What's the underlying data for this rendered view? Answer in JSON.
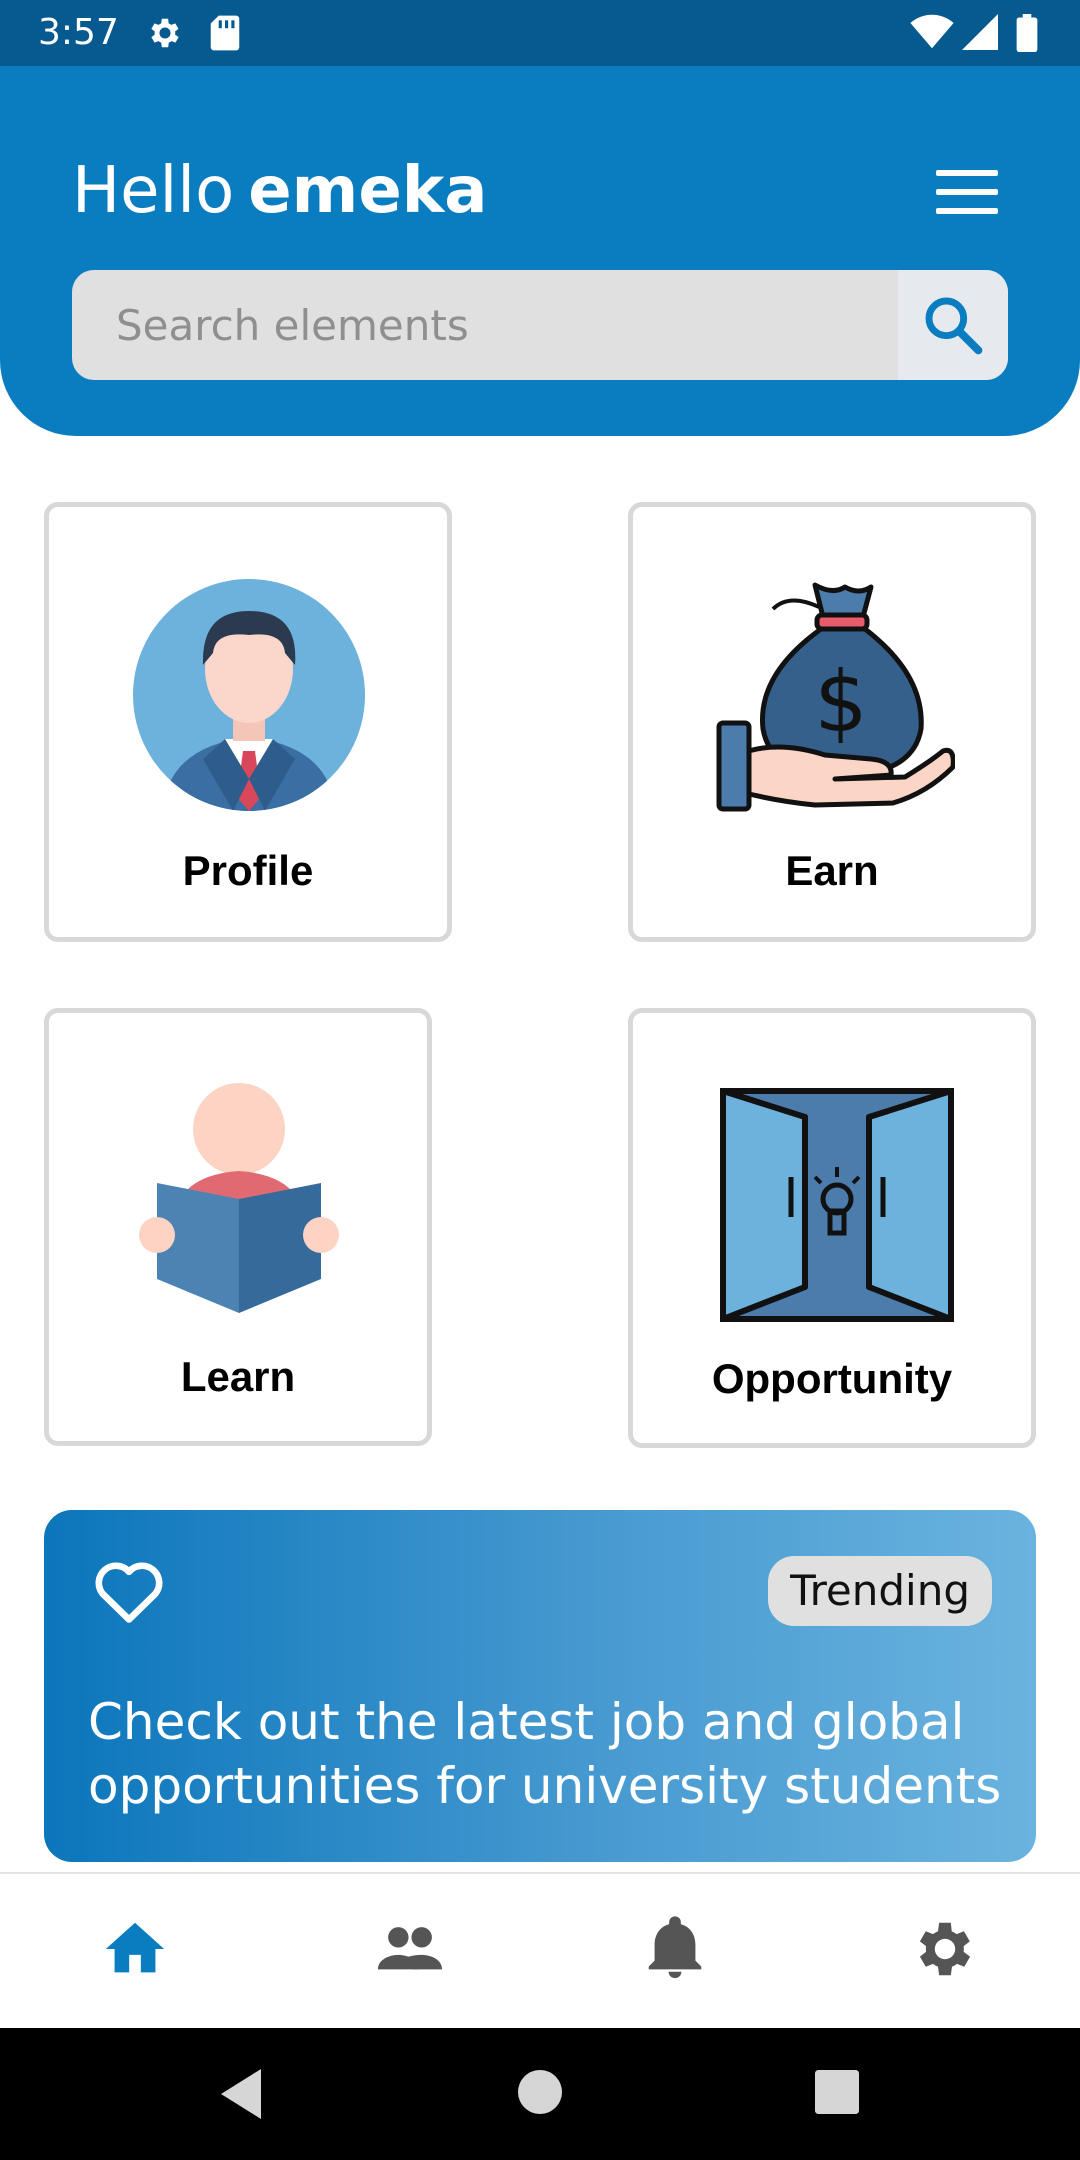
{
  "status_bar": {
    "time": "3:57",
    "icons": [
      "settings-gear-icon",
      "sd-card-icon",
      "wifi-icon",
      "signal-icon",
      "battery-icon"
    ]
  },
  "header": {
    "greeting_prefix": "Hello",
    "user_name": "emeka",
    "menu_icon": "hamburger-menu-icon"
  },
  "search": {
    "placeholder": "Search elements",
    "value": "",
    "icon": "search-icon"
  },
  "cards": [
    {
      "label": "Profile",
      "icon": "businessman-avatar-icon"
    },
    {
      "label": "Earn",
      "icon": "money-bag-in-hand-icon"
    },
    {
      "label": "Learn",
      "icon": "person-reading-book-icon"
    },
    {
      "label": "Opportunity",
      "icon": "open-door-lightbulb-icon"
    }
  ],
  "trending": {
    "badge": "Trending",
    "text": "Check out the latest job and global opportunities for university students",
    "icon": "heart-outline-icon"
  },
  "bottom_nav": [
    {
      "name": "home",
      "icon": "home-icon",
      "active": true
    },
    {
      "name": "people",
      "icon": "people-icon",
      "active": false
    },
    {
      "name": "notifications",
      "icon": "bell-icon",
      "active": false
    },
    {
      "name": "settings",
      "icon": "gear-icon",
      "active": false
    }
  ],
  "colors": {
    "primary": "#0a7cc0",
    "status_bar": "#075a8f",
    "active_nav": "#0a7cc0",
    "inactive_nav": "#555555",
    "card_border": "#d8d8d8"
  }
}
